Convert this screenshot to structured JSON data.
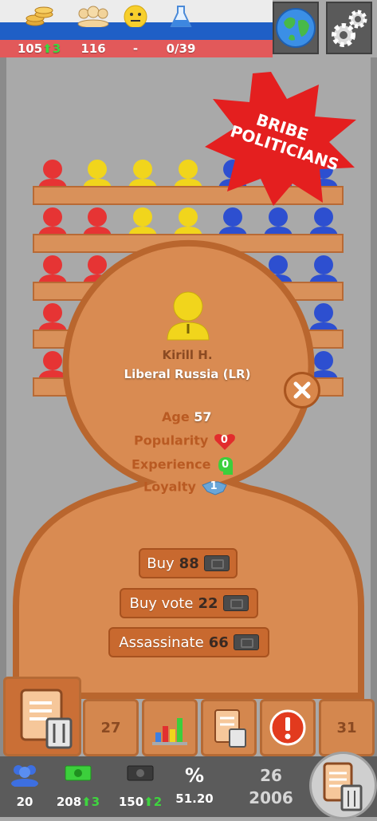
{
  "topbar": {
    "money": "105",
    "money_change": "3",
    "population": "116",
    "mood": "-",
    "research": "0/39",
    "icons": [
      "coins-icon",
      "crowd-icon",
      "neutral-face-icon",
      "flask-icon",
      "globe-icon",
      "gear-icon"
    ]
  },
  "badge": {
    "line1": "BRIBE",
    "line2": "POLITICIANS",
    "color": "#e41f1f"
  },
  "person": {
    "name": "Kirill H.",
    "party": "Liberal Russia (LR)",
    "age_label": "Age",
    "age": "57",
    "popularity_label": "Popularity",
    "popularity": "0",
    "experience_label": "Experience",
    "experience": "0",
    "loyalty_label": "Loyalty",
    "loyalty": "1"
  },
  "actions": [
    {
      "label": "Buy",
      "cost": "88"
    },
    {
      "label": "Buy vote",
      "cost": "22"
    },
    {
      "label": "Assassinate",
      "cost": "66"
    }
  ],
  "tabs": [
    "",
    "27",
    "",
    "",
    "",
    "31"
  ],
  "status": {
    "people": "20",
    "income": "208",
    "income_change": "3",
    "expense": "150",
    "expense_change": "2",
    "percent_label": "%",
    "percent": "51.20"
  },
  "date": {
    "day": "26",
    "year": "2006"
  },
  "colors": {
    "party_red": "#e63434",
    "party_yellow": "#f1d51c",
    "party_blue": "#2d4fd0",
    "card": "#d98b52"
  }
}
